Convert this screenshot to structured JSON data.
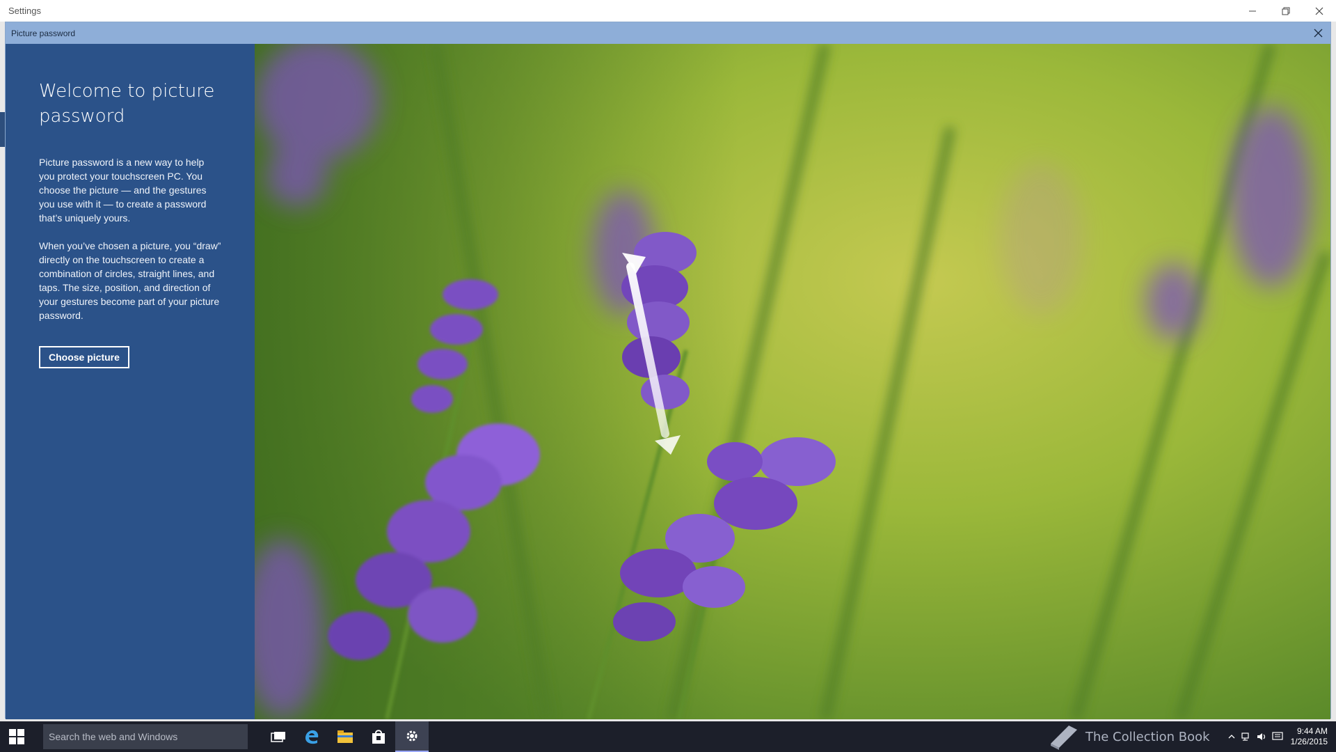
{
  "window": {
    "title": "Settings"
  },
  "dialog": {
    "title": "Picture password",
    "heading": "Welcome to picture password",
    "paragraph1": "Picture password is a new way to help you protect your touchscreen PC. You choose the picture — and the gestures you use with it — to create a password that’s uniquely yours.",
    "paragraph2": "When you’ve chosen a picture, you “draw” directly on the touchscreen to create a combination of circles, straight lines, and taps. The size, position, and direction of your gestures become part of your picture password.",
    "choose_button": "Choose picture"
  },
  "taskbar": {
    "search_placeholder": "Search the web and Windows",
    "apps": [
      "task-view-icon",
      "edge-icon",
      "file-explorer-icon",
      "store-icon",
      "settings-icon"
    ],
    "watermark": "The Collection Book",
    "time": "9:44 AM",
    "date": "1/26/2015"
  },
  "colors": {
    "accent": "#2b5289",
    "dialog_header": "#8eaed8",
    "taskbar": "#1c1f2a"
  }
}
